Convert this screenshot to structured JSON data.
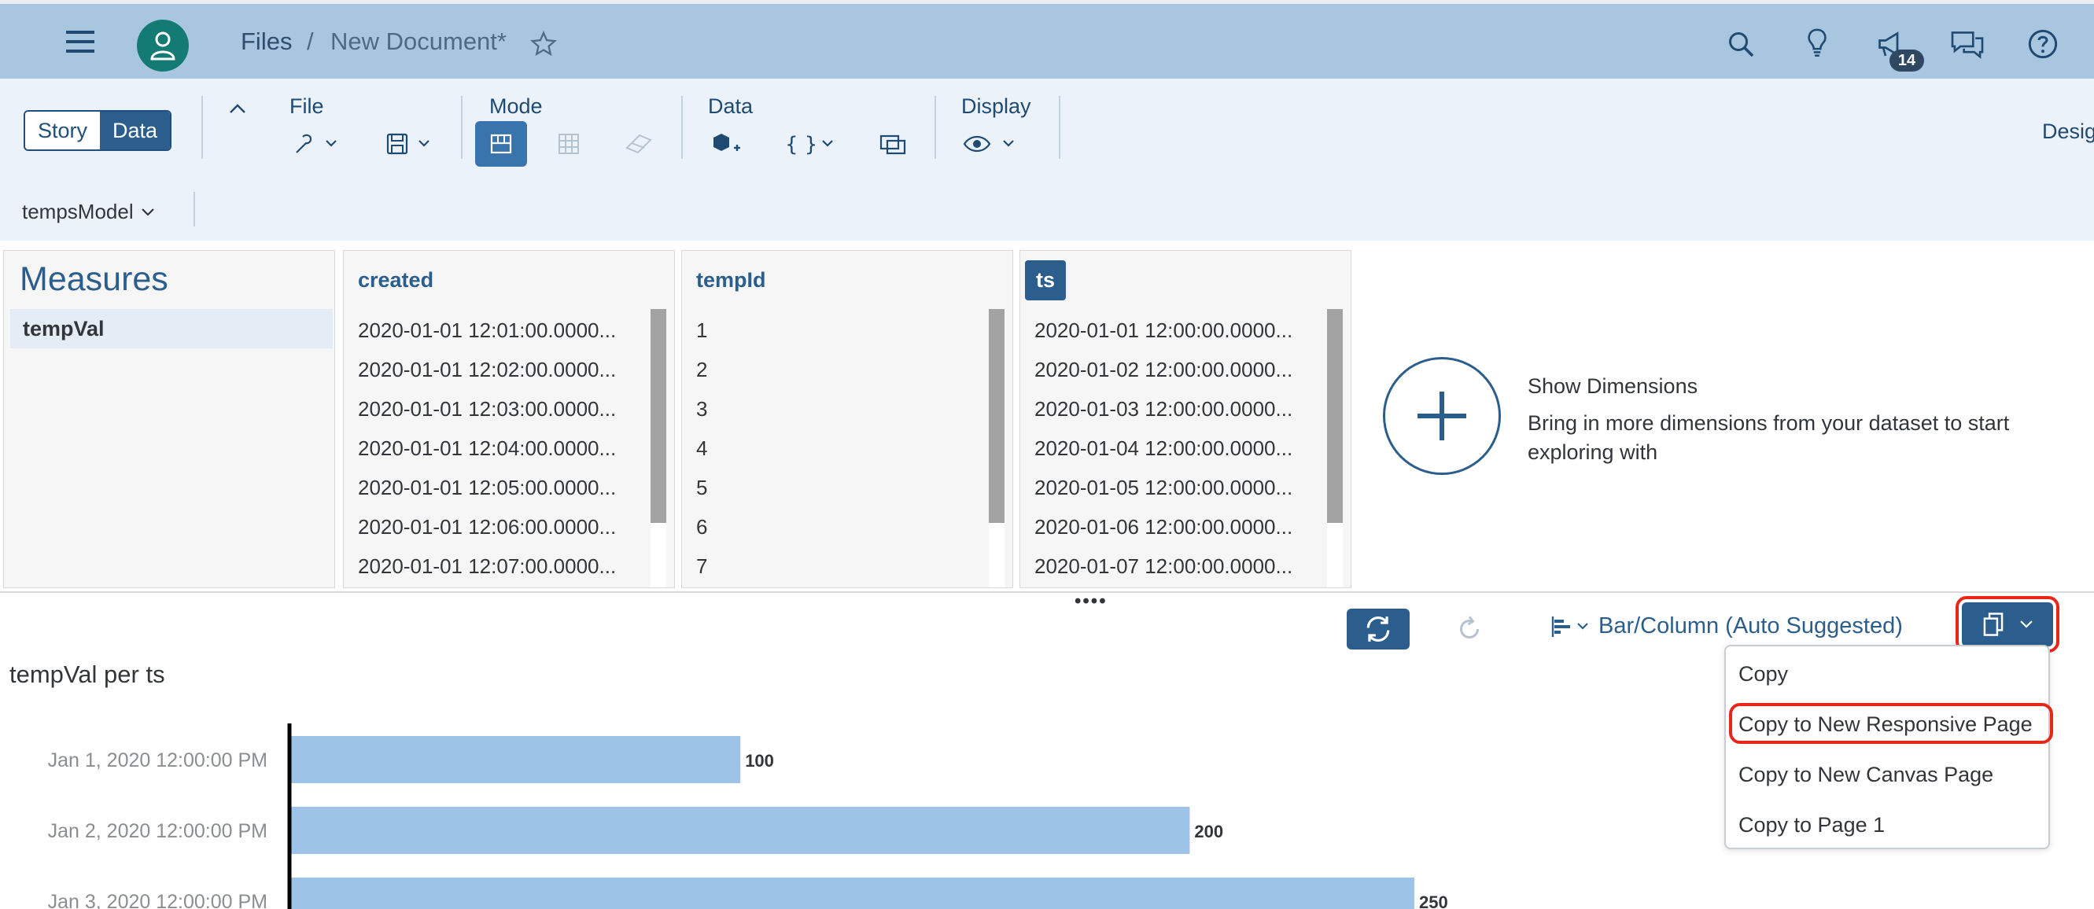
{
  "shell": {
    "breadcrumb_files": "Files",
    "breadcrumb_sep": "/",
    "document_title": "New Document*",
    "notification_count": "14"
  },
  "toolbar": {
    "story_label": "Story",
    "data_label": "Data",
    "file_label": "File",
    "mode_label": "Mode",
    "data_group_label": "Data",
    "display_label": "Display",
    "design_label": "Designer",
    "model_name": "tempsModel"
  },
  "measures": {
    "title": "Measures",
    "items": [
      "tempVal"
    ]
  },
  "columns": {
    "created": {
      "header": "created",
      "rows": [
        "2020-01-01 12:01:00.0000...",
        "2020-01-01 12:02:00.0000...",
        "2020-01-01 12:03:00.0000...",
        "2020-01-01 12:04:00.0000...",
        "2020-01-01 12:05:00.0000...",
        "2020-01-01 12:06:00.0000...",
        "2020-01-01 12:07:00.0000..."
      ]
    },
    "tempid": {
      "header": "tempId",
      "rows": [
        "1",
        "2",
        "3",
        "4",
        "5",
        "6",
        "7"
      ]
    },
    "ts": {
      "header": "ts",
      "rows": [
        "2020-01-01 12:00:00.0000...",
        "2020-01-02 12:00:00.0000...",
        "2020-01-03 12:00:00.0000...",
        "2020-01-04 12:00:00.0000...",
        "2020-01-05 12:00:00.0000...",
        "2020-01-06 12:00:00.0000...",
        "2020-01-07 12:00:00.0000..."
      ]
    }
  },
  "show_dimensions": {
    "title": "Show Dimensions",
    "description": "Bring in more dimensions from your dataset to start exploring with"
  },
  "chart_toolbar": {
    "chart_type_label": "Bar/Column (Auto Suggested)"
  },
  "copy_menu": {
    "items": [
      "Copy",
      "Copy to New Responsive Page",
      "Copy to New Canvas Page",
      "Copy to Page 1"
    ]
  },
  "colors": {
    "shell_bg": "#a9c6e1",
    "accent": "#2b5e8d",
    "bar": "#9dc3e6",
    "highlight": "#e8261c"
  },
  "chart_data": {
    "type": "bar",
    "title": "tempVal per ts",
    "orientation": "horizontal",
    "categories": [
      "Jan 1, 2020 12:00:00 PM",
      "Jan 2, 2020 12:00:00 PM",
      "Jan 3, 2020 12:00:00 PM"
    ],
    "values": [
      100,
      200,
      250
    ],
    "data_labels": [
      "100",
      "200",
      "250"
    ],
    "xlim": [
      0,
      250
    ]
  }
}
